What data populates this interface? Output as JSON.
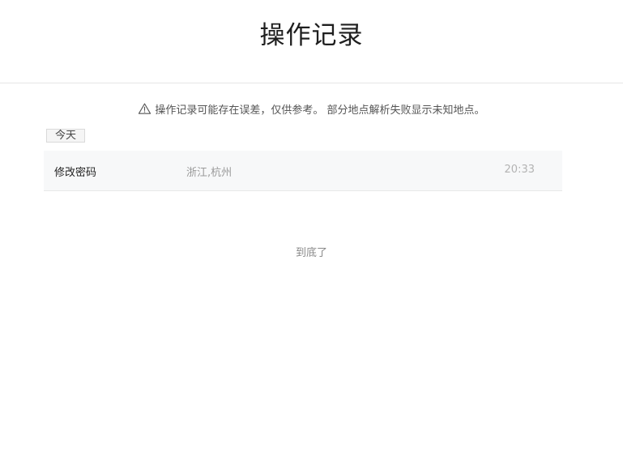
{
  "page": {
    "title": "操作记录"
  },
  "notice": {
    "icon": "warning-icon",
    "text": "操作记录可能存在误差，仅供参考。 部分地点解析失败显示未知地点。"
  },
  "groups": [
    {
      "date_label": "今天",
      "records": [
        {
          "action": "修改密码",
          "location": "浙江,杭州",
          "time": "20:33"
        }
      ]
    }
  ],
  "footer": {
    "end_text": "到底了"
  }
}
